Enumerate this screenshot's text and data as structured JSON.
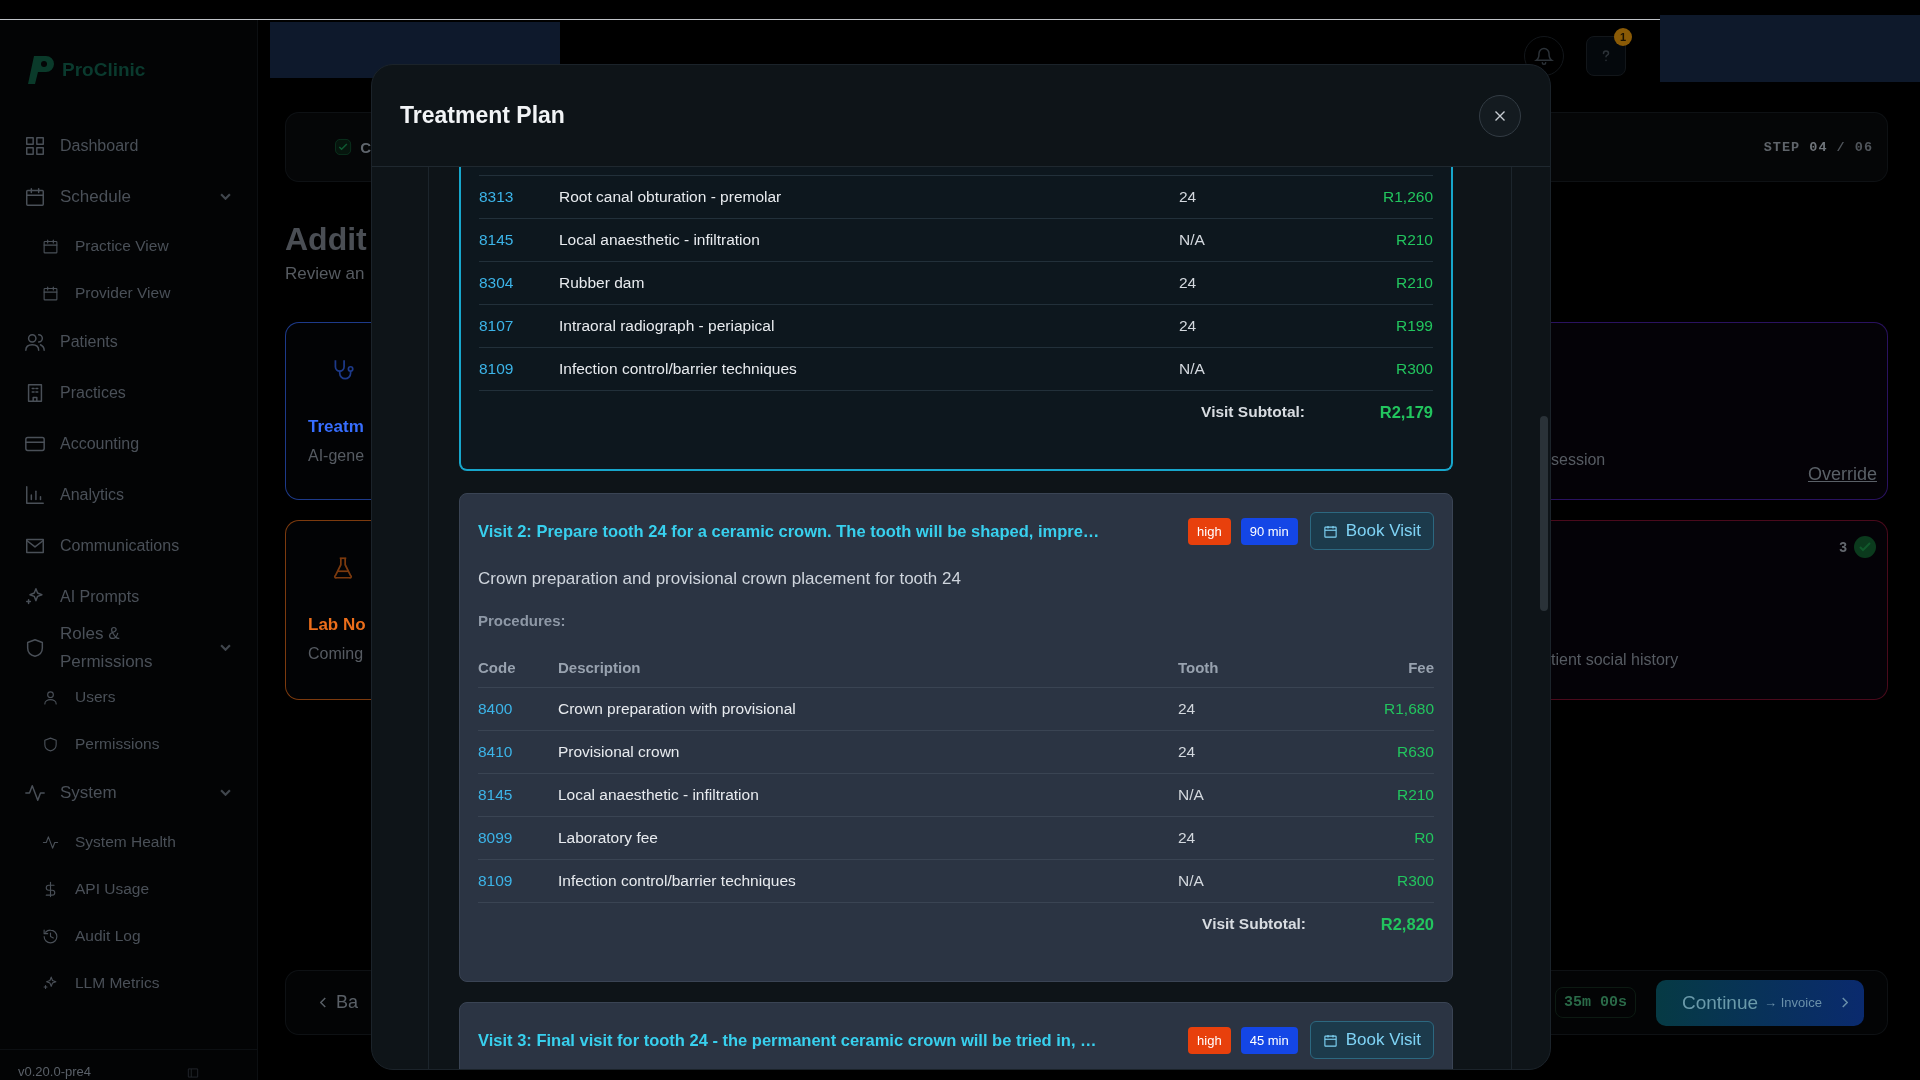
{
  "header": {
    "notification_count": "1"
  },
  "sidebar": {
    "logo": "ProClinic",
    "items": [
      {
        "label": "Dashboard"
      },
      {
        "label": "Schedule",
        "expanded": true,
        "children": [
          {
            "label": "Practice View"
          },
          {
            "label": "Provider View"
          }
        ]
      },
      {
        "label": "Patients"
      },
      {
        "label": "Practices"
      },
      {
        "label": "Accounting"
      },
      {
        "label": "Analytics"
      },
      {
        "label": "Communications"
      },
      {
        "label": "AI Prompts"
      },
      {
        "label": "Roles & Permissions",
        "expanded": true,
        "children": [
          {
            "label": "Users"
          },
          {
            "label": "Permissions"
          }
        ]
      },
      {
        "label": "System",
        "expanded": true,
        "children": [
          {
            "label": "System Health"
          },
          {
            "label": "API Usage"
          },
          {
            "label": "Audit Log"
          },
          {
            "label": "LLM Metrics"
          }
        ]
      }
    ],
    "version": "v0.20.0-pre4"
  },
  "page": {
    "progress": {
      "completed": true,
      "current_step_fragment": "C",
      "step_label": "STEP",
      "step_current": "04",
      "step_separator": "/",
      "step_total": "06"
    },
    "heading": "Addit",
    "subheading": "Review an",
    "left_cards": [
      {
        "title": "Treatm",
        "subtitle": "AI-gene",
        "color": "#1d3a8a"
      },
      {
        "title": "Lab No",
        "subtitle": "Coming",
        "color": "#7c3a0e"
      }
    ],
    "right_cards": [
      {
        "kind": "override",
        "text": "session",
        "link": "Override",
        "color": "#2a1260"
      },
      {
        "kind": "count",
        "count": "3",
        "text": "tient social history",
        "color": "#4a0a1c"
      }
    ],
    "back_button": "Ba",
    "timer": "35m 00s",
    "continue_button": {
      "label": "Continue",
      "target": "→ Invoice"
    }
  },
  "modal": {
    "title": "Treatment Plan",
    "visits": [
      {
        "highlighted": true,
        "procedures": [
          {
            "code": "8313",
            "description": "Root canal obturation - premolar",
            "tooth": "24",
            "fee": "R1,260"
          },
          {
            "code": "8145",
            "description": "Local anaesthetic - infiltration",
            "tooth": "N/A",
            "fee": "R210"
          },
          {
            "code": "8304",
            "description": "Rubber dam",
            "tooth": "24",
            "fee": "R210"
          },
          {
            "code": "8107",
            "description": "Intraoral radiograph - periapical",
            "tooth": "24",
            "fee": "R199"
          },
          {
            "code": "8109",
            "description": "Infection control/barrier techniques",
            "tooth": "N/A",
            "fee": "R300"
          }
        ],
        "subtotal_label": "Visit Subtotal:",
        "subtotal": "R2,179"
      },
      {
        "highlighted": false,
        "title": "Visit 2: Prepare tooth 24 for a ceramic crown. The tooth will be shaped, impre…",
        "priority": "high",
        "duration": "90 min",
        "book_button": "Book Visit",
        "description": "Crown preparation and provisional crown placement for tooth 24",
        "procedures_label": "Procedures:",
        "columns": [
          "Code",
          "Description",
          "Tooth",
          "Fee"
        ],
        "procedures": [
          {
            "code": "8400",
            "description": "Crown preparation with provisional",
            "tooth": "24",
            "fee": "R1,680"
          },
          {
            "code": "8410",
            "description": "Provisional crown",
            "tooth": "24",
            "fee": "R630"
          },
          {
            "code": "8145",
            "description": "Local anaesthetic - infiltration",
            "tooth": "N/A",
            "fee": "R210"
          },
          {
            "code": "8099",
            "description": "Laboratory fee",
            "tooth": "24",
            "fee": "R0"
          },
          {
            "code": "8109",
            "description": "Infection control/barrier techniques",
            "tooth": "N/A",
            "fee": "R300"
          }
        ],
        "subtotal_label": "Visit Subtotal:",
        "subtotal": "R2,820"
      },
      {
        "highlighted": false,
        "title": "Visit 3: Final visit for tooth 24 - the permanent ceramic crown will be tried in, …",
        "priority": "high",
        "duration": "45 min",
        "book_button": "Book Visit"
      }
    ]
  }
}
